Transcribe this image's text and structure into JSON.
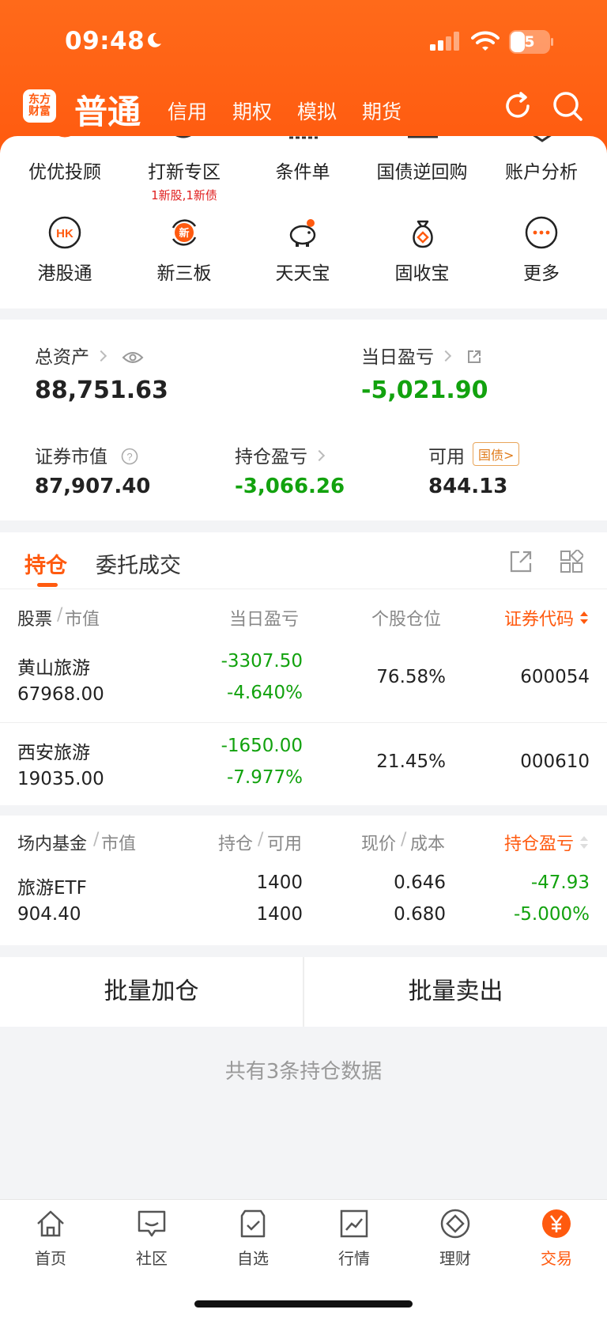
{
  "status_bar": {
    "time": "09:48",
    "battery": "5"
  },
  "header": {
    "logo": [
      "东方",
      "财富"
    ],
    "account_type": "普通",
    "tabs": [
      "信用",
      "期权",
      "模拟",
      "期货"
    ]
  },
  "quick_menu": {
    "row1": [
      {
        "label": "优优投顾"
      },
      {
        "label": "打新专区",
        "sub": "1新股,1新债"
      },
      {
        "label": "条件单"
      },
      {
        "label": "国债逆回购"
      },
      {
        "label": "账户分析"
      }
    ],
    "row2": [
      {
        "label": "港股通",
        "icon_text": "HK"
      },
      {
        "label": "新三板",
        "icon_text": "新"
      },
      {
        "label": "天天宝"
      },
      {
        "label": "固收宝"
      },
      {
        "label": "更多"
      }
    ]
  },
  "assets": {
    "total_label": "总资产",
    "total_value": "88,751.63",
    "daily_pl_label": "当日盈亏",
    "daily_pl_value": "-5,021.90",
    "market_value_label": "证券市值",
    "market_value": "87,907.40",
    "position_pl_label": "持仓盈亏",
    "position_pl_value": "-3,066.26",
    "available_label": "可用",
    "available_tag": "国债>",
    "available_value": "844.13"
  },
  "holdings": {
    "tab_active": "持仓",
    "tab_other": "委托成交",
    "headers": {
      "stock": "股票",
      "market_value": "市值",
      "daily_pl": "当日盈亏",
      "weight": "个股仓位",
      "code": "证券代码"
    },
    "rows": [
      {
        "name": "黄山旅游",
        "value": "67968.00",
        "pl": "-3307.50",
        "pl_pct": "-4.640%",
        "weight": "76.58%",
        "code": "600054"
      },
      {
        "name": "西安旅游",
        "value": "19035.00",
        "pl": "-1650.00",
        "pl_pct": "-7.977%",
        "weight": "21.45%",
        "code": "000610"
      }
    ]
  },
  "funds": {
    "headers": {
      "fund": "场内基金",
      "market_value": "市值",
      "position": "持仓",
      "available": "可用",
      "price": "现价",
      "cost": "成本",
      "pl": "持仓盈亏"
    },
    "rows": [
      {
        "name": "旅游ETF",
        "value": "904.40",
        "position": "1400",
        "available": "1400",
        "price": "0.646",
        "cost": "0.680",
        "pl": "-47.93",
        "pl_pct": "-5.000%"
      }
    ]
  },
  "actions": {
    "batch_add": "批量加仓",
    "batch_sell": "批量卖出"
  },
  "summary": "共有3条持仓数据",
  "tabbar": [
    {
      "label": "首页"
    },
    {
      "label": "社区"
    },
    {
      "label": "自选"
    },
    {
      "label": "行情"
    },
    {
      "label": "理财"
    },
    {
      "label": "交易"
    }
  ],
  "colors": {
    "brand": "#ff5a0f",
    "loss": "#12a20e",
    "highlight": "#e02020"
  }
}
